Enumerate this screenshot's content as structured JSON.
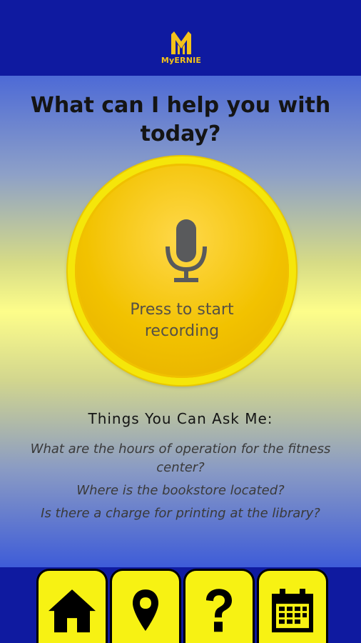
{
  "app": {
    "logo_text": "MyERNIE",
    "colors": {
      "header_blue": "#0f1aa0",
      "accent_yellow": "#f7f213",
      "button_gold": "#f2c200",
      "logo_gold": "#f4c21a"
    }
  },
  "main": {
    "title": "What can I help you with today?",
    "record_button": {
      "icon": "microphone-icon",
      "label": "Press to start recording"
    },
    "ask_heading": "Things You Can Ask Me:",
    "suggestions": [
      "What are the hours of operation for the fitness center?",
      "Where is the bookstore located?",
      "Is there a charge for printing at the library?"
    ]
  },
  "nav": {
    "items": [
      {
        "icon": "home-icon"
      },
      {
        "icon": "map-pin-icon"
      },
      {
        "icon": "question-mark-icon"
      },
      {
        "icon": "calendar-icon"
      }
    ]
  }
}
